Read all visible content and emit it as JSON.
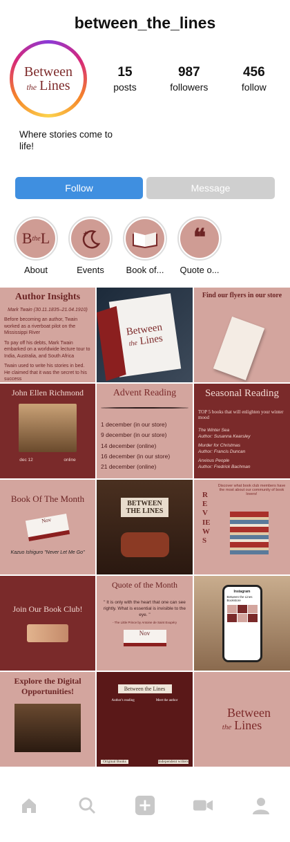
{
  "profile": {
    "username": "between_the_lines",
    "bio": "Where stories come to life!",
    "stats": [
      {
        "value": "15",
        "label": "posts"
      },
      {
        "value": "987",
        "label": "followers"
      },
      {
        "value": "456",
        "label": "follow"
      }
    ],
    "logo": {
      "line1": "Between",
      "line2": "the",
      "line3": "Lines"
    }
  },
  "buttons": {
    "follow": "Follow",
    "message": "Message"
  },
  "highlights": [
    {
      "label": "About",
      "icon": "book-logo-icon"
    },
    {
      "label": "Events",
      "icon": "moon-star-icon"
    },
    {
      "label": "Book of...",
      "icon": "open-book-icon"
    },
    {
      "label": "Quote o...",
      "icon": "quote-icon"
    }
  ],
  "posts": {
    "p1": {
      "title": "Author Insights",
      "sub": "Mark Twain (30.11.1835–21.04.1910)",
      "bullets": [
        "Before becoming an author, Twain worked as a riverboat pilot on the Mississippi River",
        "To pay off his debts, Mark Twain embarked on a worldwide lecture tour to India, Australia, and South Africa",
        "Twain used to write his stories in bed. He claimed that it was the secret to his success"
      ]
    },
    "p2": {
      "logo1": "Between",
      "logo2": "the",
      "logo3": "Lines"
    },
    "p3": {
      "title": "Find our flyers in our store"
    },
    "p4": {
      "title": "John Ellen Richmond",
      "date": "dec 12",
      "mode": "online"
    },
    "p5": {
      "title": "Advent Reading",
      "items": [
        "1 december (in our store)",
        "9 december (in our store)",
        "14 december (online)",
        "16 december (in our store)",
        "21 december (online)"
      ]
    },
    "p6": {
      "title": "Seasonal Reading",
      "sub": "TOP 5 books that will enlighten your winter mood",
      "books": [
        "The Winter Sea",
        "Author: Susanna Kearsley",
        "Murder for Christmas",
        "Author: Francis Duncan",
        "Anxious People",
        "Author: Fredrick Bachman"
      ]
    },
    "p7": {
      "title": "Book Of The Month",
      "book": "Kazuo Ishiguro \"Never Let Me Go\"",
      "badge": "Nov"
    },
    "p8": {
      "sign1": "BETWEEN",
      "sign2": "THE LINES"
    },
    "p9": {
      "side": "REVIEWS",
      "text": "Discover what book club members have the most about our community of book lovers!"
    },
    "p10": {
      "title": "Join Our Book Club!"
    },
    "p11": {
      "title": "Quote of the Month",
      "quote": "\" It is only with the heart that one can see rightly. What is essential is invisible to the eye. \"",
      "author": "- The Little Prince by Antoine de Saint Exupéry",
      "badge": "Nov"
    },
    "p12": {
      "app": "Instagram",
      "name": "Between the Lines Bookstore"
    },
    "p13": {
      "title": "Explore the Digital Opportunities!"
    },
    "p14": {
      "sign": "Between the Lines",
      "left": "Original Books",
      "right": "Independent writers",
      "w1": "Author's reading",
      "w2": "Meet the author"
    },
    "p15": {
      "logo1": "Between",
      "logo2": "the",
      "logo3": "Lines"
    }
  },
  "nav": [
    "home-icon",
    "search-icon",
    "add-icon",
    "video-icon",
    "profile-icon"
  ]
}
